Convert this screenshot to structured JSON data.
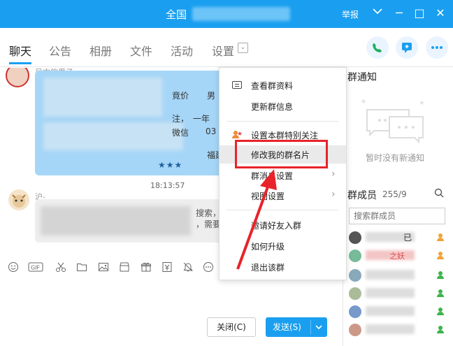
{
  "window": {
    "title": "全国",
    "report_label": "举报",
    "controls": [
      "─",
      "□",
      "✕"
    ]
  },
  "tabs": {
    "items": [
      "聊天",
      "公告",
      "相册",
      "文件",
      "活动",
      "设置"
    ],
    "dropdown_glyph": "⌄"
  },
  "chat": {
    "time": "18:13:57",
    "sender1": "风中的男子",
    "sender2": "沪-",
    "bubble1_fragments": [
      "竟价",
      "男",
      "注，",
      "一年",
      "微信",
      "03",
      "福建"
    ],
    "bubble2_fragments": [
      "搜索，纯人肉推广，品牌",
      "，需要加我，谢谢"
    ]
  },
  "toolbar": {
    "icons": [
      "smile-icon",
      "gif-icon",
      "scissors-icon",
      "folder-icon",
      "image-icon",
      "shop-icon",
      "gift-icon",
      "money-icon",
      "bell-icon",
      "more-icon"
    ]
  },
  "buttons": {
    "close": "关闭(C)",
    "send": "发送(S)"
  },
  "right_panel": {
    "notice_title": "群通知",
    "notice_empty": "暂时没有新通知",
    "members_title": "群成员",
    "members_count": "255/9",
    "search_placeholder": "搜索群成员",
    "visible_name_fragments": [
      "已",
      "之妖"
    ]
  },
  "context_menu": {
    "items": [
      {
        "label": "查看群资料",
        "icon": "card-icon"
      },
      {
        "label": "更新群信息",
        "icon": ""
      },
      {
        "label": "设置本群特别关注",
        "icon": "focus-icon"
      },
      {
        "label": "修改我的群名片",
        "icon": ""
      },
      {
        "label": "群消息设置",
        "icon": "",
        "submenu": true
      },
      {
        "label": "视图设置",
        "icon": "",
        "submenu": true
      },
      {
        "label": "邀请好友入群",
        "icon": ""
      },
      {
        "label": "如何升级",
        "icon": ""
      },
      {
        "label": "退出该群",
        "icon": ""
      }
    ],
    "highlighted_index": 3,
    "chevron_glyph": "›"
  },
  "colors": {
    "brand_blue": "#1a9ff0",
    "annotation_red": "#e8232a",
    "bubble_blue": "#a6d6f7"
  }
}
